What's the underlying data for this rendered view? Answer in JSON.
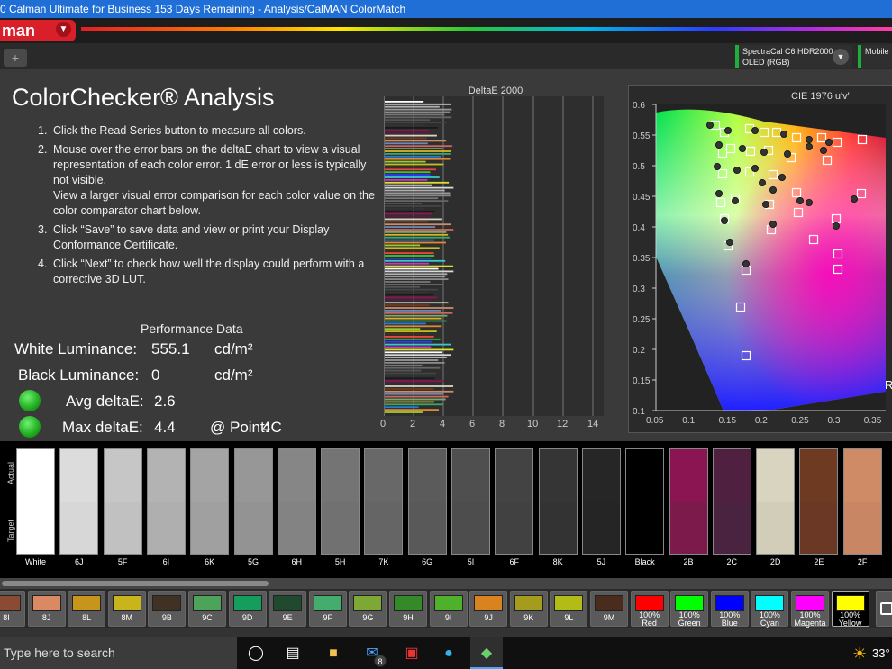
{
  "window": {
    "title": "0 Calman Ultimate for Business 153 Days Remaining  - Analysis/CalMAN ColorMatch"
  },
  "header": {
    "logo_text": "man",
    "logo_menu_icon": "chevron-down-icon"
  },
  "tabs": {
    "add_label": "+"
  },
  "devices": {
    "meter_name": "SpectraCal C6 HDR2000",
    "meter_mode": "OLED (RGB)",
    "second_label": "Mobile"
  },
  "analysis": {
    "title": "ColorChecker® Analysis",
    "steps": [
      {
        "num": "1.",
        "text": "Click the Read Series button to measure all colors."
      },
      {
        "num": "2.",
        "text": "Mouse over the error bars on the deltaE chart to view a visual representation of each color error. 1 dE error or less is typically not visible."
      },
      {
        "num": "",
        "text": "View a larger visual error comparison for each color value on the color comparator chart below."
      },
      {
        "num": "3.",
        "text": "Click “Save” to save data and view or print your Display Conformance Certificate."
      },
      {
        "num": "4.",
        "text": "Click “Next” to check how well the display could perform with a corrective 3D LUT."
      }
    ]
  },
  "performance": {
    "title": "Performance Data",
    "white_label": "White Luminance:",
    "white_value": "555.1",
    "white_unit": "cd/m²",
    "black_label": "Black Luminance:",
    "black_value": "0",
    "black_unit": "cd/m²",
    "avg_label": "Avg deltaE:",
    "avg_value": "2.6",
    "max_label": "Max deltaE:",
    "max_value": "4.4",
    "point_label": "@ Point:",
    "point_value": "4C",
    "status_color": "#1faa1f"
  },
  "deltae_chart": {
    "title": "DeltaE 2000",
    "ticks": [
      "0",
      "2",
      "4",
      "6",
      "8",
      "10",
      "12",
      "14"
    ]
  },
  "cie_chart": {
    "title": "CIE 1976 u'v'",
    "y_ticks": [
      "0.6",
      "0.55",
      "0.5",
      "0.45",
      "0.4",
      "0.35",
      "0.3",
      "0.25",
      "0.2",
      "0.15",
      "0.1"
    ],
    "x_ticks": [
      "0.05",
      "0.1",
      "0.15",
      "0.2",
      "0.25",
      "0.3",
      "0.35"
    ],
    "corner_label": "R"
  },
  "swatches": {
    "actual_label": "Actual",
    "target_label": "Target",
    "items": [
      {
        "label": "White",
        "actual": "#ffffff",
        "target": "#ffffff"
      },
      {
        "label": "6J",
        "actual": "#dcdcdc",
        "target": "#d7d7d7"
      },
      {
        "label": "5F",
        "actual": "#c6c6c6",
        "target": "#c1c1c1"
      },
      {
        "label": "6I",
        "actual": "#b3b3b3",
        "target": "#afafaf"
      },
      {
        "label": "6K",
        "actual": "#a4a4a4",
        "target": "#a0a0a0"
      },
      {
        "label": "5G",
        "actual": "#979797",
        "target": "#939393"
      },
      {
        "label": "6H",
        "actual": "#868686",
        "target": "#838383"
      },
      {
        "label": "5H",
        "actual": "#747474",
        "target": "#717171"
      },
      {
        "label": "7K",
        "actual": "#686868",
        "target": "#656565"
      },
      {
        "label": "6G",
        "actual": "#5b5b5b",
        "target": "#595959"
      },
      {
        "label": "5I",
        "actual": "#4f4f4f",
        "target": "#4d4d4d"
      },
      {
        "label": "6F",
        "actual": "#434343",
        "target": "#414141"
      },
      {
        "label": "8K",
        "actual": "#353535",
        "target": "#333333"
      },
      {
        "label": "5J",
        "actual": "#262626",
        "target": "#252525"
      },
      {
        "label": "Black",
        "actual": "#000000",
        "target": "#000000"
      },
      {
        "label": "2B",
        "actual": "#8a1552",
        "target": "#7d1a4c"
      },
      {
        "label": "2C",
        "actual": "#4f2040",
        "target": "#4a2340"
      },
      {
        "label": "2D",
        "actual": "#d8d4c0",
        "target": "#d2cdb9"
      },
      {
        "label": "2E",
        "actual": "#6e3a22",
        "target": "#6a3824"
      },
      {
        "label": "2F",
        "actual": "#cf8a66",
        "target": "#c98665"
      }
    ]
  },
  "points": {
    "items": [
      {
        "label": "8I",
        "color": "#8a4a34"
      },
      {
        "label": "8J",
        "color": "#d98a64"
      },
      {
        "label": "8L",
        "color": "#c8951c"
      },
      {
        "label": "8M",
        "color": "#c9b41c"
      },
      {
        "label": "9B",
        "color": "#3f3124"
      },
      {
        "label": "9C",
        "color": "#4ea35a"
      },
      {
        "label": "9D",
        "color": "#149d5c"
      },
      {
        "label": "9E",
        "color": "#1f4a2f"
      },
      {
        "label": "9F",
        "color": "#44ac6c"
      },
      {
        "label": "9G",
        "color": "#7ea836"
      },
      {
        "label": "9H",
        "color": "#348a28"
      },
      {
        "label": "9I",
        "color": "#4fb02c"
      },
      {
        "label": "9J",
        "color": "#d98320"
      },
      {
        "label": "9K",
        "color": "#a49c1c"
      },
      {
        "label": "9L",
        "color": "#b2bc16"
      },
      {
        "label": "9M",
        "color": "#4a2c1c"
      },
      {
        "label": "100% Red",
        "color": "#ff0000"
      },
      {
        "label": "100% Green",
        "color": "#00ff00"
      },
      {
        "label": "100% Blue",
        "color": "#0000ff"
      },
      {
        "label": "100% Cyan",
        "color": "#00ffff"
      },
      {
        "label": "100% Magenta",
        "color": "#ff00ff"
      },
      {
        "label": "100% Yellow",
        "color": "#ffff00"
      }
    ]
  },
  "taskbar": {
    "search_placeholder": "Type here to search",
    "mail_badge": "8",
    "temperature": "33°"
  },
  "colors": {
    "titlebar": "#1f6fd6",
    "brand_red": "#d81f2a",
    "device_green": "#1fae3a"
  }
}
